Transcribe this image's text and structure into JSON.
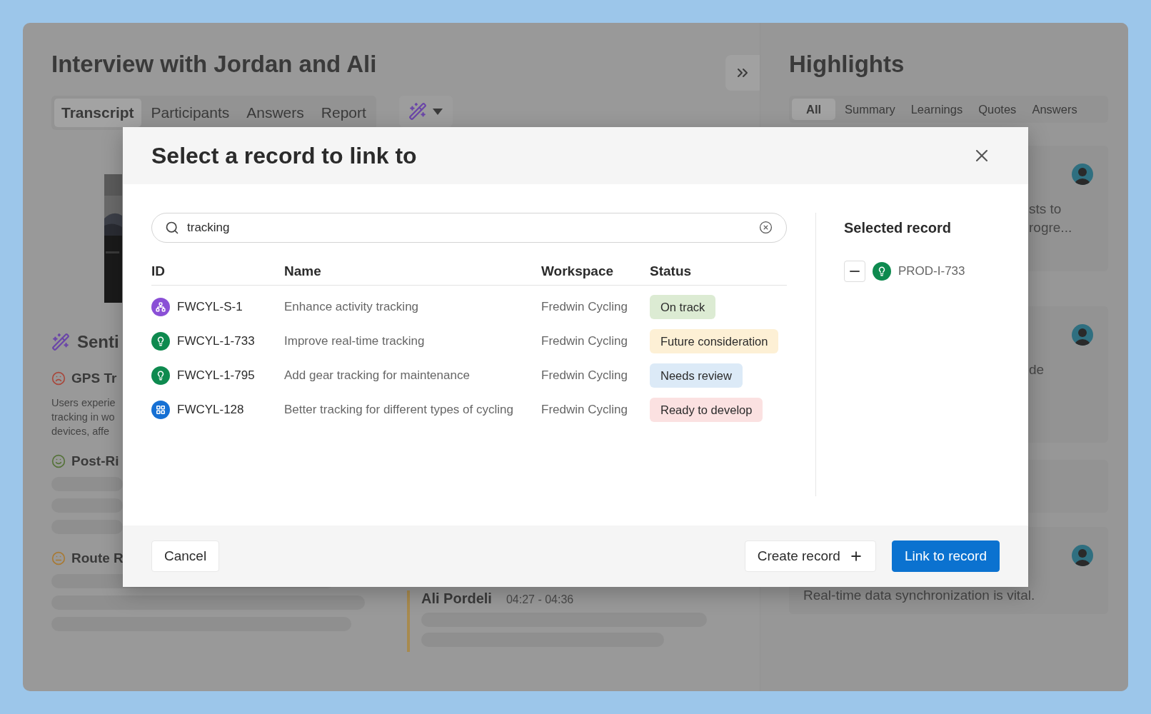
{
  "interview": {
    "title": "Interview with Jordan and Ali",
    "tabs": [
      {
        "label": "Transcript",
        "selected": true
      },
      {
        "label": "Participants",
        "selected": false
      },
      {
        "label": "Answers",
        "selected": false
      },
      {
        "label": "Report",
        "selected": false
      }
    ],
    "sentiment": {
      "heading": "Senti",
      "items": [
        {
          "kind": "negative",
          "title": "GPS Tr",
          "lines": [
            "Users experie",
            "tracking in wo",
            "devices, affe"
          ]
        },
        {
          "kind": "positive",
          "title": "Post-Ri"
        },
        {
          "kind": "neutral",
          "title": "Route R"
        }
      ]
    },
    "transcript_entry": {
      "speaker": "Ali Pordeli",
      "time": "04:27 - 04:36"
    }
  },
  "highlights": {
    "title": "Highlights",
    "tabs": [
      {
        "label": "All",
        "selected": true
      },
      {
        "label": "Summary",
        "selected": false
      },
      {
        "label": "Learnings",
        "selected": false
      },
      {
        "label": "Quotes",
        "selected": false
      },
      {
        "label": "Answers",
        "selected": false
      }
    ],
    "cards": [
      {
        "kind": "partial",
        "avatar": true,
        "lines": [
          "sts to",
          "rogre..."
        ]
      },
      {
        "kind": "partial",
        "avatar": true,
        "lines": [
          "de"
        ]
      },
      {
        "kind": "partial",
        "avatar": false
      },
      {
        "kind": "full",
        "avatar": true,
        "lines": [
          "Real-time data synchronization is vital."
        ]
      }
    ]
  },
  "dialog": {
    "title": "Select a record to link to",
    "search": {
      "value": "tracking"
    },
    "columns": [
      "ID",
      "Name",
      "Workspace",
      "Status"
    ],
    "rows": [
      {
        "kind": "strategy",
        "id": "FWCYL-S-1",
        "name": "Enhance activity tracking",
        "workspace": "Fredwin Cycling",
        "status": "On track",
        "color": "#dcebd3"
      },
      {
        "kind": "idea",
        "id": "FWCYL-1-733",
        "name": "Improve real-time tracking",
        "workspace": "Fredwin Cycling",
        "status": "Future consideration",
        "color": "#fdf0d5"
      },
      {
        "kind": "idea",
        "id": "FWCYL-1-795",
        "name": "Add gear tracking for maintenance",
        "workspace": "Fredwin Cycling",
        "status": "Needs review",
        "color": "#dceaf7"
      },
      {
        "kind": "feature",
        "id": "FWCYL-128",
        "name": "Better tracking for different types of cycling",
        "workspace": "Fredwin Cycling",
        "status": "Ready to develop",
        "color": "#fbe1e1"
      }
    ],
    "selected_heading": "Selected record",
    "selected": [
      {
        "kind": "idea",
        "id": "PROD-I-733"
      }
    ],
    "buttons": {
      "cancel": "Cancel",
      "create": "Create record",
      "link": "Link to record"
    }
  }
}
